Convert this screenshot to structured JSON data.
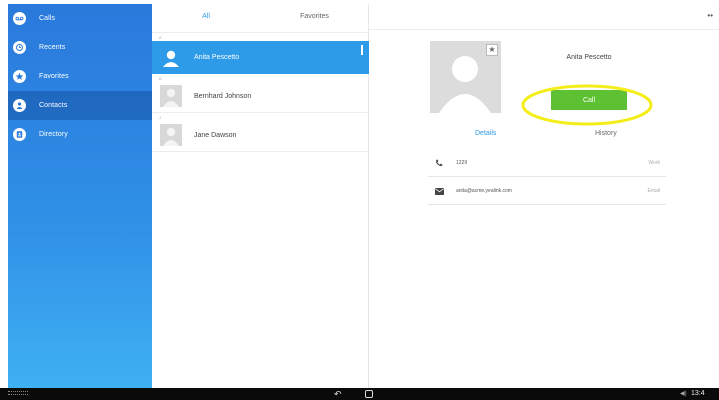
{
  "sidebar": {
    "items": [
      {
        "label": "Calls",
        "icon": "voicemail-icon",
        "active": false
      },
      {
        "label": "Recents",
        "icon": "clock-icon",
        "active": false
      },
      {
        "label": "Favorites",
        "icon": "star-icon",
        "active": false
      },
      {
        "label": "Contacts",
        "icon": "person-icon",
        "active": true
      },
      {
        "label": "Directory",
        "icon": "directory-icon",
        "active": false
      }
    ]
  },
  "list": {
    "tabs": {
      "all": "All",
      "favorites": "Favorites"
    },
    "contacts": [
      {
        "letter": "A",
        "name": "Anita Pescetto",
        "selected": true
      },
      {
        "letter": "B",
        "name": "Bernhard Johnson",
        "selected": false
      },
      {
        "letter": "J",
        "name": "Jane Dawson",
        "selected": false
      }
    ]
  },
  "detail": {
    "name": "Anita Pescetto",
    "call_label": "Call",
    "tabs": {
      "details": "Details",
      "history": "History"
    },
    "phone": {
      "value": "1229",
      "type": "Work"
    },
    "email": {
      "value": "anita@acme.yealink.com",
      "type": "Email"
    },
    "overflow": "••"
  },
  "statusbar": {
    "clock": "13:4",
    "back_glyph": "↶"
  },
  "colors": {
    "accent": "#2d9be8",
    "call": "#5dc133",
    "highlight": "#f3ee1a"
  }
}
